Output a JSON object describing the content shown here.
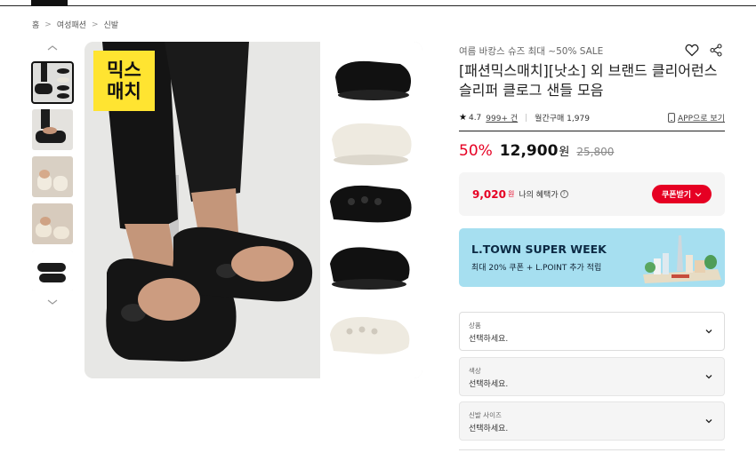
{
  "breadcrumb": [
    "홈",
    "여성패션",
    "신발"
  ],
  "main_image": {
    "badge_line1": "믹스",
    "badge_line2": "매치"
  },
  "product": {
    "promo": "여름 바캉스 슈즈 최대 ~50% SALE",
    "title": "[패션믹스매치][낫소] 외 브랜드 클리어런스 슬리퍼 클로그 샌들 모음",
    "rating": "4.7",
    "review_count": "999+ 건",
    "monthly_sales": "월간구매 1,979",
    "app_link": "APP으로 보기"
  },
  "price": {
    "discount_rate": "50%",
    "sale_price": "12,900",
    "currency": "원",
    "original_price": "25,800"
  },
  "benefit": {
    "amount": "9,020",
    "unit": "원",
    "label": "나의 혜택가",
    "info_icon": "?",
    "coupon_button": "쿠폰받기"
  },
  "banner": {
    "title": "L.TOWN SUPER WEEK",
    "subtitle": "최대 20% 쿠폰 + L.POINT 추가 적립"
  },
  "options": [
    {
      "label": "상품",
      "value": "선택하세요."
    },
    {
      "label": "색상",
      "value": "선택하세요."
    },
    {
      "label": "신발 사이즈",
      "value": "선택하세요."
    }
  ],
  "colors": {
    "accent": "#e60023",
    "badge": "#ffe431",
    "banner_bg": "#a6dff0"
  }
}
